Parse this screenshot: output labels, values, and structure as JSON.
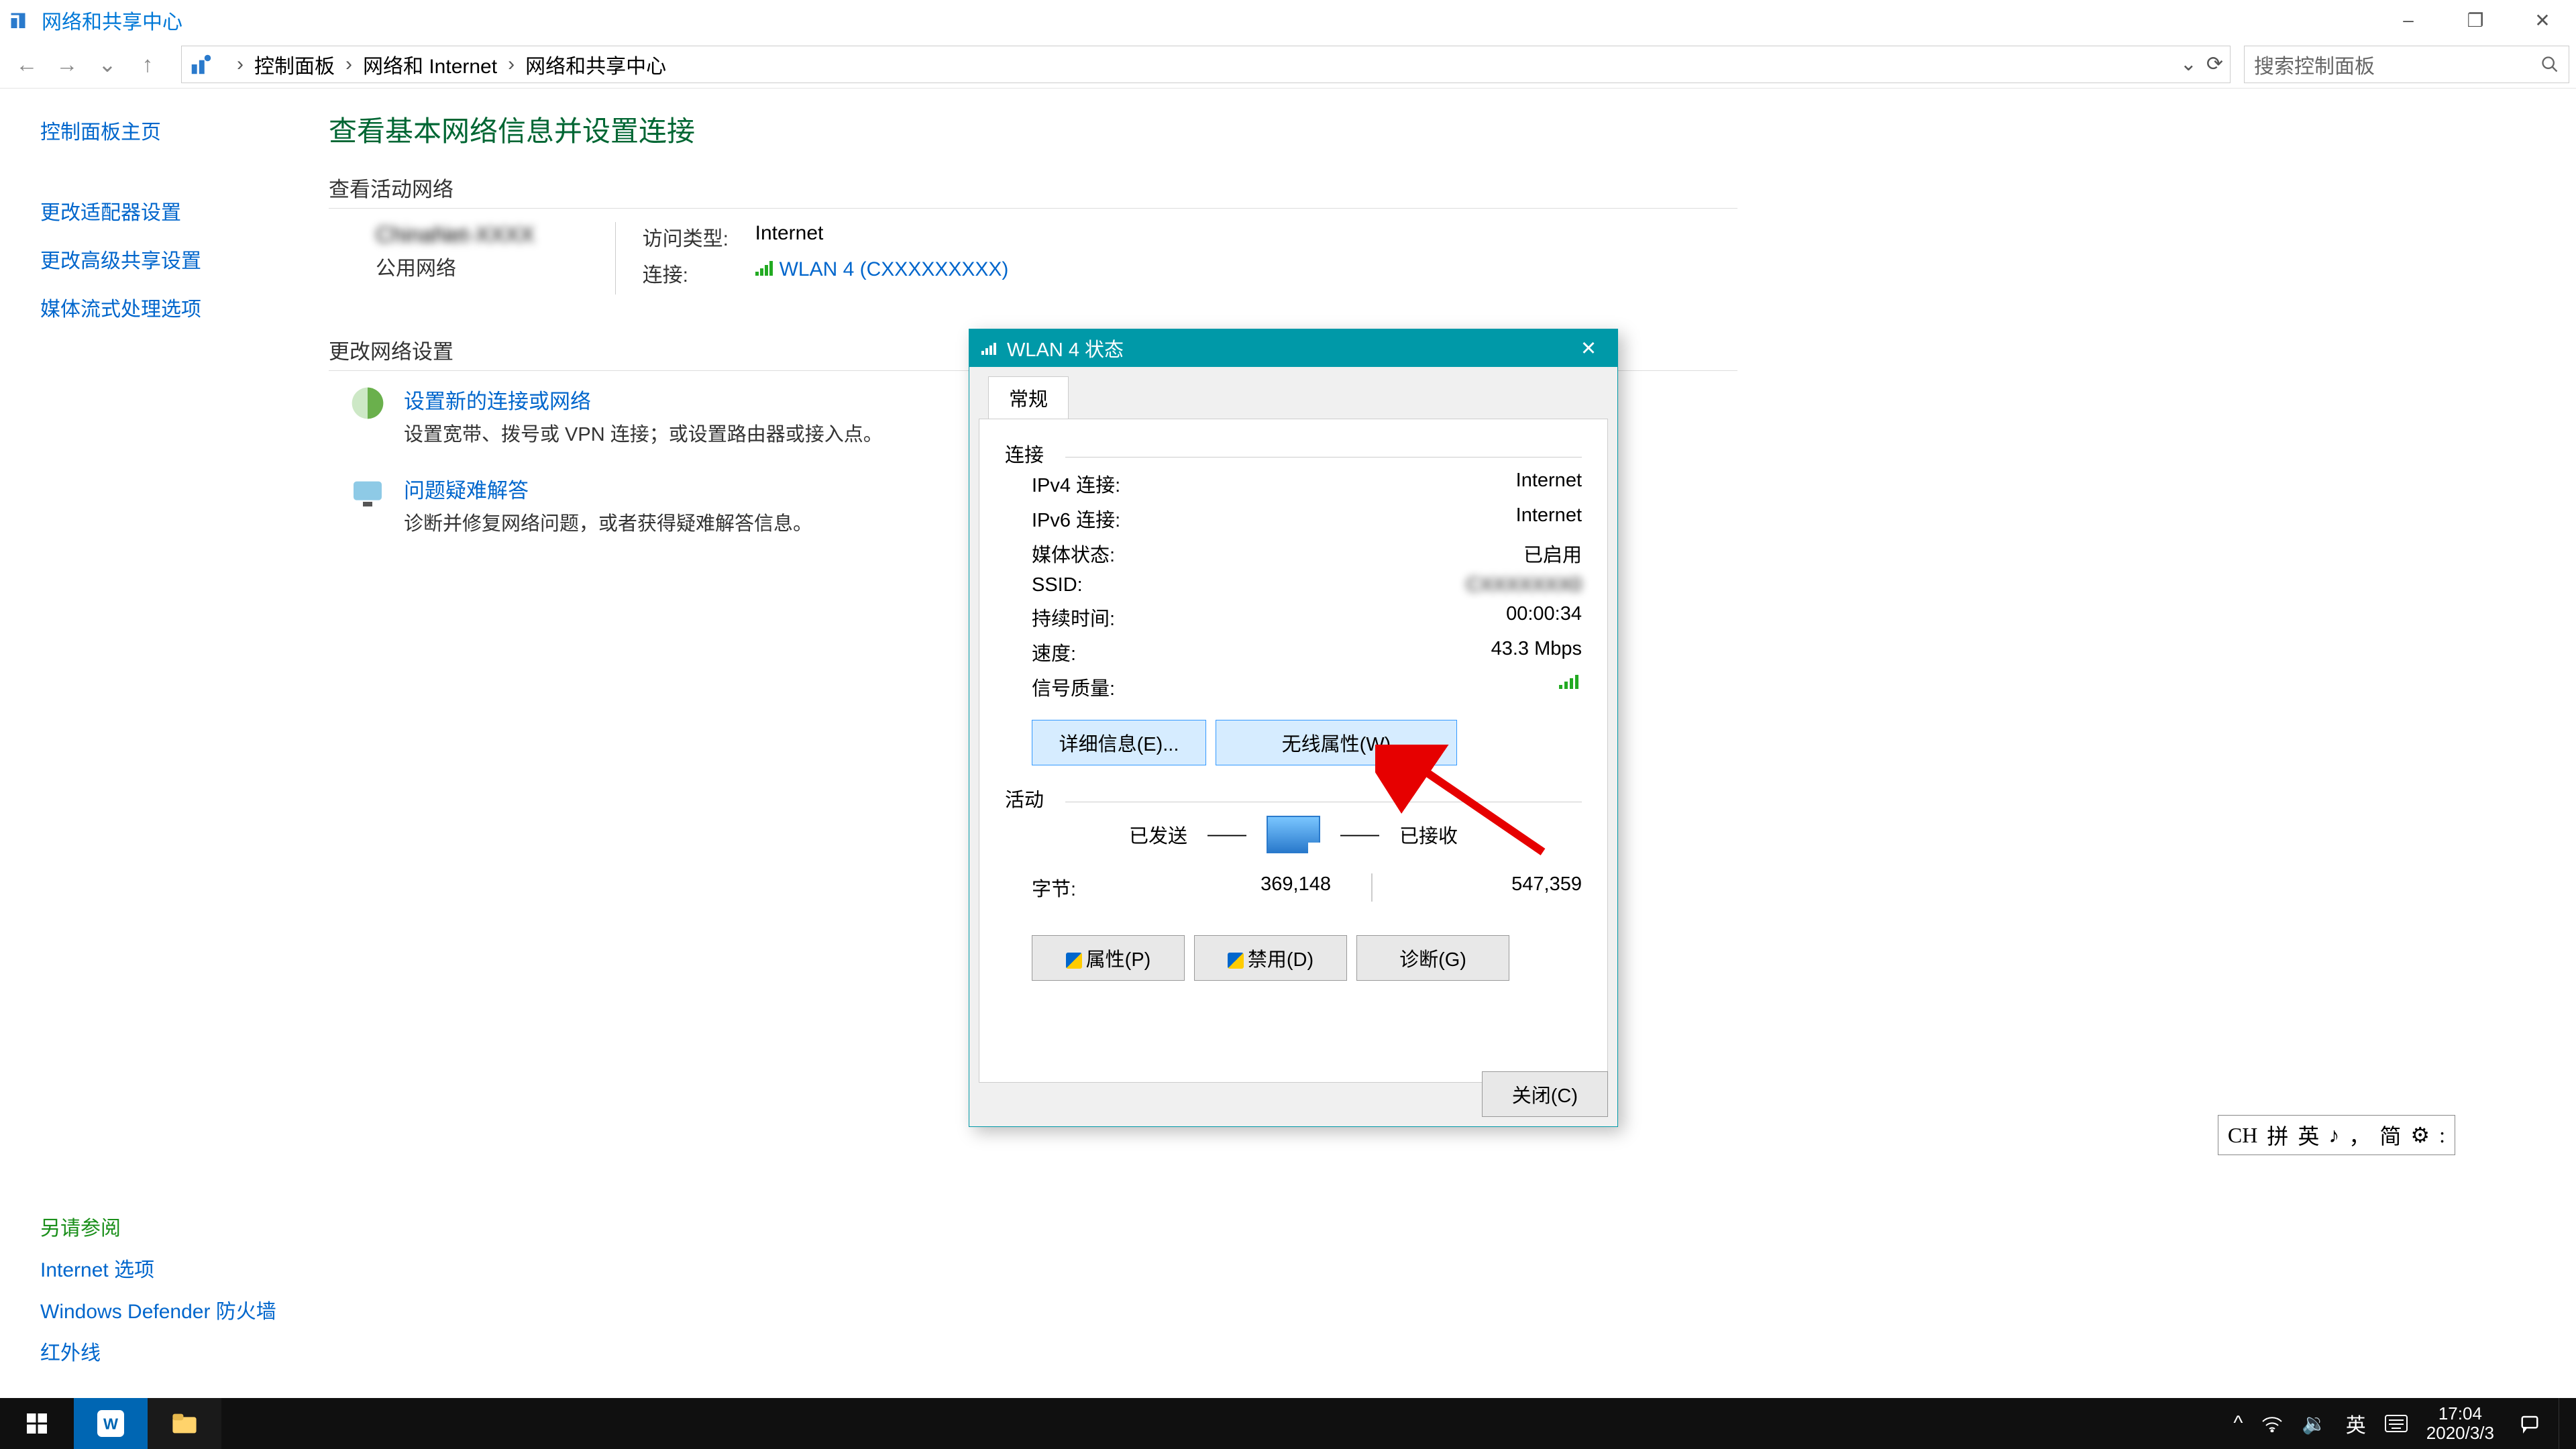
{
  "window": {
    "title": "网络和共享中心",
    "minimize": "–",
    "maximize": "❐",
    "close": "✕"
  },
  "breadcrumb": {
    "items": [
      "控制面板",
      "网络和 Internet",
      "网络和共享中心"
    ],
    "refresh": "⟳",
    "dropdown": "⌄"
  },
  "search": {
    "placeholder": "搜索控制面板"
  },
  "leftnav": {
    "home": "控制面板主页",
    "items": [
      "更改适配器设置",
      "更改高级共享设置",
      "媒体流式处理选项"
    ],
    "see_also_label": "另请参阅",
    "see_also": [
      "Internet 选项",
      "Windows Defender 防火墙",
      "红外线"
    ]
  },
  "content": {
    "heading": "查看基本网络信息并设置连接",
    "active_label": "查看活动网络",
    "network_name": "ChinaNet-XXXX",
    "network_type": "公用网络",
    "access_label": "访问类型:",
    "access_value": "Internet",
    "conn_label": "连接:",
    "conn_value": "WLAN 4 (CXXXXXXXXX)",
    "change_label": "更改网络设置",
    "task1_title": "设置新的连接或网络",
    "task1_desc": "设置宽带、拨号或 VPN 连接；或设置路由器或接入点。",
    "task2_title": "问题疑难解答",
    "task2_desc": "诊断并修复网络问题，或者获得疑难解答信息。"
  },
  "dialog": {
    "title": "WLAN 4 状态",
    "tab_general": "常规",
    "grp_conn": "连接",
    "rows": {
      "ipv4_k": "IPv4 连接:",
      "ipv4_v": "Internet",
      "ipv6_k": "IPv6 连接:",
      "ipv6_v": "Internet",
      "media_k": "媒体状态:",
      "media_v": "已启用",
      "ssid_k": "SSID:",
      "ssid_v": "CXXXXXXX0",
      "dur_k": "持续时间:",
      "dur_v": "00:00:34",
      "speed_k": "速度:",
      "speed_v": "43.3 Mbps",
      "sig_k": "信号质量:"
    },
    "btn_details": "详细信息(E)...",
    "btn_wireless": "无线属性(W)",
    "grp_activity": "活动",
    "sent_label": "已发送",
    "recv_label": "已接收",
    "bytes_label": "字节:",
    "bytes_sent": "369,148",
    "bytes_recv": "547,359",
    "btn_props": "属性(P)",
    "btn_disable": "禁用(D)",
    "btn_diag": "诊断(G)",
    "btn_close": "关闭(C)"
  },
  "ime": {
    "items": [
      "CH",
      "拼",
      "英",
      "♪",
      "，",
      "简",
      "⚙",
      ":"
    ]
  },
  "taskbar": {
    "tray": [
      "^",
      "🔉",
      "英",
      "⌨"
    ],
    "wifi_icon": "wifi",
    "clock_time": "17:04",
    "clock_date": "2020/3/3",
    "notif": "💬"
  }
}
